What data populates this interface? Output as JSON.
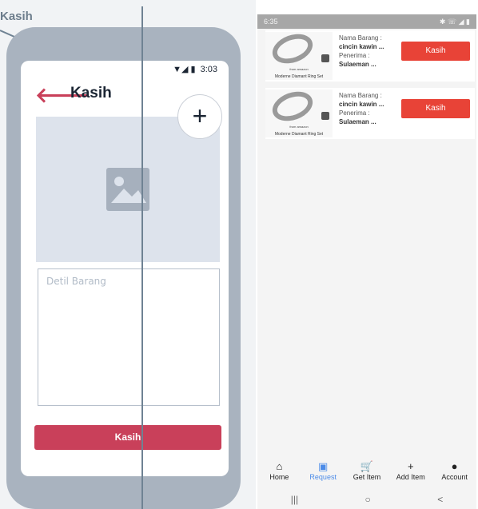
{
  "wireframe": {
    "label": "Kasih",
    "status_time": "3:03",
    "status_icons": "▼◢ ▮",
    "back_icon": "🡐",
    "title": "Kasih",
    "plus_icon": "+",
    "detail_placeholder": "Detil Barang",
    "kasih_button": "Kasih"
  },
  "app": {
    "status_time": "6:35",
    "status_right": "✱ ☏ ◢ ▮",
    "items": [
      {
        "image_tiny": "from amazon",
        "image_caption": "Moderne Diamant Ring Set",
        "name_label": "Nama Barang :",
        "name_value": "cincin kawin ...",
        "receiver_label": "Penerima :",
        "receiver_value": "Sulaeman ...",
        "button": "Kasih"
      },
      {
        "image_tiny": "from amazon",
        "image_caption": "Moderne Diamant Ring Set",
        "name_label": "Nama Barang :",
        "name_value": "cincin kawin ...",
        "receiver_label": "Penerima :",
        "receiver_value": "Sulaeman ...",
        "button": "Kasih"
      }
    ],
    "nav": [
      {
        "label": "Home",
        "icon": "⌂"
      },
      {
        "label": "Request",
        "icon": "▣"
      },
      {
        "label": "Get Item",
        "icon": "🛒"
      },
      {
        "label": "Add Item",
        "icon": "+"
      },
      {
        "label": "Account",
        "icon": "●"
      }
    ],
    "active_nav": "Request",
    "gesture": [
      "|||",
      "○",
      "<"
    ],
    "colors": {
      "accent_button": "#e84337",
      "active_nav": "#4b8be8",
      "wireframe_button": "#c9405a"
    }
  }
}
